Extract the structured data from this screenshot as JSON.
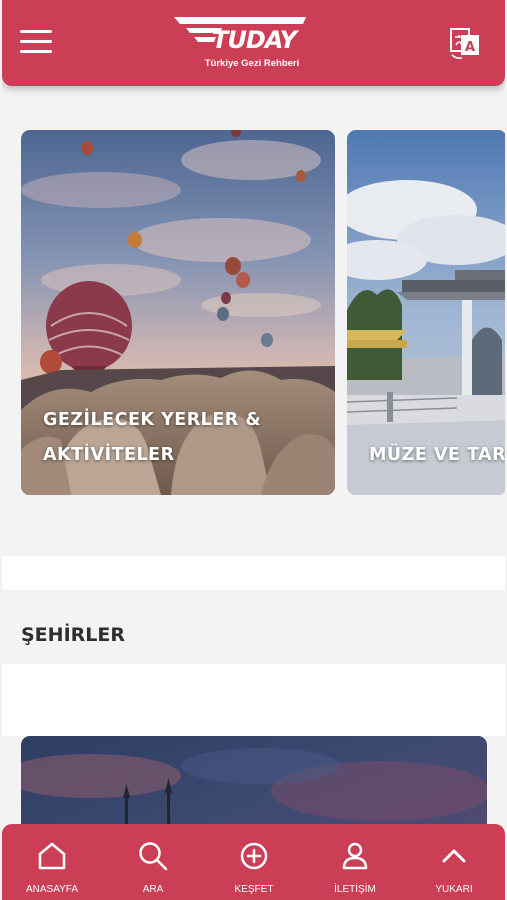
{
  "header": {
    "logo_word": "TUDAY",
    "logo_tagline": "Türkiye Gezi Rehberi",
    "menu_icon": "hamburger-icon",
    "language_icon": "translate-icon",
    "color": "#cc3e55"
  },
  "carousel": {
    "cards": [
      {
        "line1": "GEZİLECEK YERLER &",
        "line2": "AKTİVİTELER",
        "image": "cappadocia-balloons"
      },
      {
        "line1": "MÜZE VE TAR",
        "image": "ottoman-pavilion"
      }
    ]
  },
  "cities": {
    "title": "ŞEHİRLER",
    "first_card_image": "mosque-skyline-dusk"
  },
  "nav": {
    "items": [
      {
        "label": "ANASAYFA",
        "icon": "home-icon"
      },
      {
        "label": "ARA",
        "icon": "search-icon"
      },
      {
        "label": "KEŞFET",
        "icon": "plus-circle-icon"
      },
      {
        "label": "İLETİŞİM",
        "icon": "user-icon"
      },
      {
        "label": "YUKARI",
        "icon": "chevron-up-icon"
      }
    ]
  }
}
